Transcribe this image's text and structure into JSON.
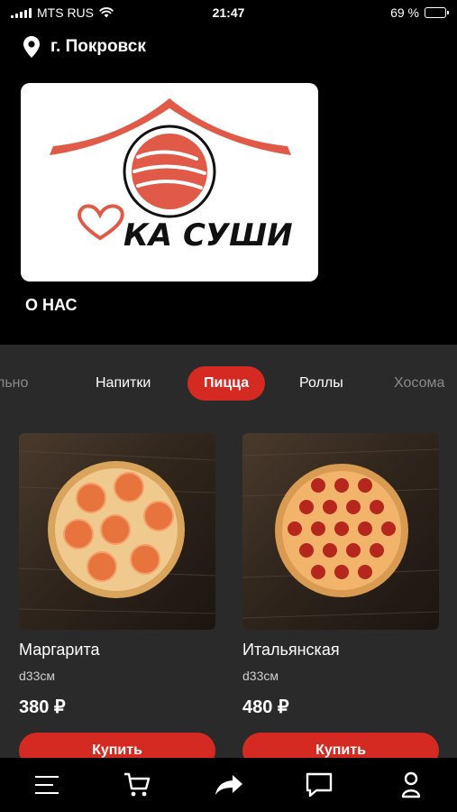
{
  "status_bar": {
    "carrier": "MTS RUS",
    "time": "21:47",
    "battery": "69 %",
    "battery_level": 0.69
  },
  "header": {
    "location_icon": "location-pin-icon",
    "city": "г. Покровск",
    "logo": {
      "text": "КА СУШИ",
      "colors": {
        "brand_red": "#e05a47",
        "ink": "#111111"
      }
    },
    "about_label": "О НАС"
  },
  "categories": [
    {
      "label": "льно",
      "faded": true
    },
    {
      "label": "Напитки"
    },
    {
      "label": "Пицца",
      "active": true
    },
    {
      "label": "Роллы"
    },
    {
      "label": "Хосома",
      "faded": true
    }
  ],
  "products": [
    {
      "name": "Маргарита",
      "size": "d33см",
      "price": "380 ₽",
      "buy_label": "Купить",
      "image": "pizza-margherita-image"
    },
    {
      "name": "Итальянская",
      "size": "d33см",
      "price": "480 ₽",
      "buy_label": "Купить",
      "image": "pizza-pepperoni-image"
    }
  ],
  "bottom_nav": [
    {
      "name": "menu-icon"
    },
    {
      "name": "cart-icon"
    },
    {
      "name": "share-icon"
    },
    {
      "name": "chat-icon"
    },
    {
      "name": "profile-icon"
    }
  ],
  "colors": {
    "accent": "#d42a22",
    "background": "#000000",
    "content_bg": "#2a2a2a"
  }
}
